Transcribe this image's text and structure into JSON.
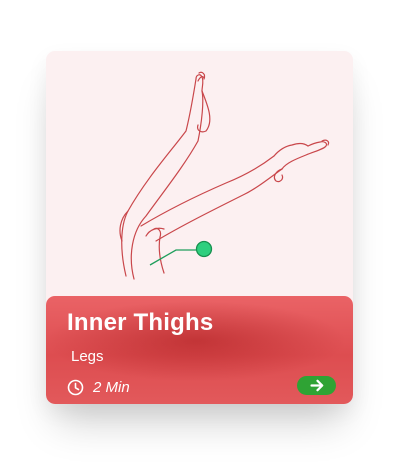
{
  "exercise_card": {
    "title": "Inner Thighs",
    "category": "Legs",
    "duration": "2 Min",
    "illustration_icon": "legs-stretch-illustration",
    "duration_icon": "clock-icon",
    "action_icon": "arrow-right-icon"
  },
  "colors": {
    "card_background": "#fcf0f1",
    "panel_red": "#dd4d50",
    "line_red": "#c9474b",
    "marker_green": "#2ecf7e",
    "button_green": "#2fa334",
    "text_white": "#ffffff"
  }
}
